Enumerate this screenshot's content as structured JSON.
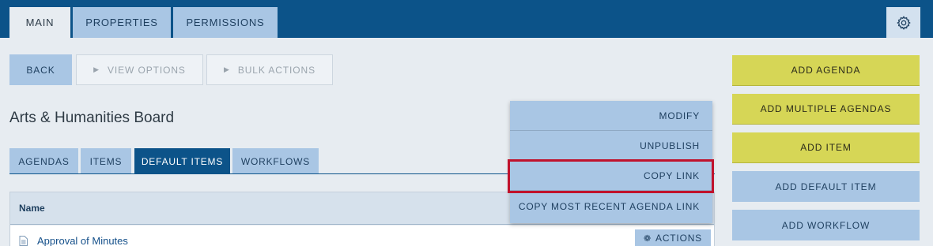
{
  "top_tabs": [
    {
      "label": "MAIN",
      "active": true
    },
    {
      "label": "PROPERTIES",
      "active": false
    },
    {
      "label": "PERMISSIONS",
      "active": false
    }
  ],
  "settings_icon": "gear-icon",
  "toolbar": {
    "back_label": "BACK",
    "view_options_label": "VIEW OPTIONS",
    "bulk_actions_label": "BULK ACTIONS"
  },
  "page_title": "Arts & Humanities Board",
  "sub_tabs": [
    {
      "label": "AGENDAS",
      "active": false
    },
    {
      "label": "ITEMS",
      "active": false
    },
    {
      "label": "DEFAULT ITEMS",
      "active": true
    },
    {
      "label": "WORKFLOWS",
      "active": false
    }
  ],
  "table": {
    "columns": [
      "Name"
    ],
    "rows": [
      {
        "name": "Approval of Minutes",
        "actions_label": "ACTIONS"
      }
    ]
  },
  "actions_menu": {
    "items": [
      "MODIFY",
      "UNPUBLISH",
      "COPY LINK",
      "COPY MOST RECENT AGENDA LINK"
    ],
    "highlighted": "COPY LINK"
  },
  "right_panel": {
    "buttons": [
      {
        "label": "ADD AGENDA",
        "color": "#d6d656"
      },
      {
        "label": "ADD MULTIPLE AGENDAS",
        "color": "#d6d656"
      },
      {
        "label": "ADD ITEM",
        "color": "#d6d656"
      },
      {
        "label": "ADD DEFAULT ITEM",
        "color": "#a9c6e4"
      },
      {
        "label": "ADD WORKFLOW",
        "color": "#a9c6e4"
      }
    ]
  },
  "colors": {
    "nav": "#0c5389",
    "tab": "#a9c6e4",
    "highlight": "#c0122c"
  }
}
